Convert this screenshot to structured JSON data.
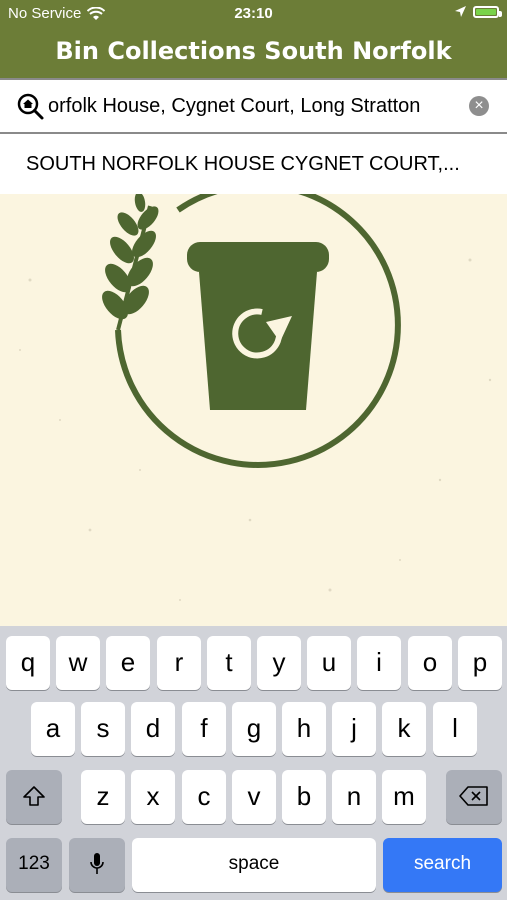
{
  "status": {
    "carrier": "No Service",
    "time": "23:10"
  },
  "header": {
    "title": "Bin Collections South Norfolk"
  },
  "search": {
    "value": "orfolk House, Cygnet Court, Long Stratton",
    "clear": "×"
  },
  "suggestion": {
    "label": "SOUTH NORFOLK HOUSE CYGNET COURT,..."
  },
  "keyboard": {
    "row1": [
      "q",
      "w",
      "e",
      "r",
      "t",
      "y",
      "u",
      "i",
      "o",
      "p"
    ],
    "row2": [
      "a",
      "s",
      "d",
      "f",
      "g",
      "h",
      "j",
      "k",
      "l"
    ],
    "row3": [
      "z",
      "x",
      "c",
      "v",
      "b",
      "n",
      "m"
    ],
    "numbers_label": "123",
    "space_label": "space",
    "search_label": "search"
  },
  "colors": {
    "brand": "#6c7d37",
    "bin_green": "#4e6630",
    "background": "#fbf5e0",
    "key_blue": "#3478f6"
  }
}
